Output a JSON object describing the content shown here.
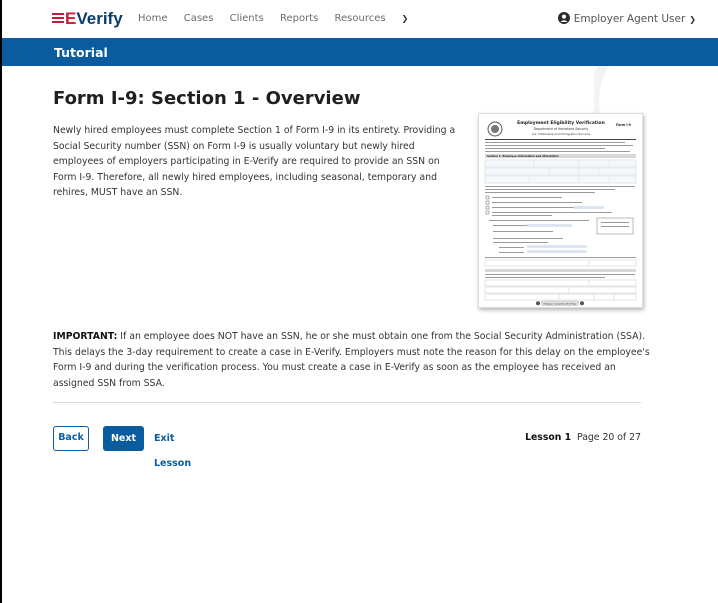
{
  "nav": {
    "logo_prefix": "E",
    "logo_suffix": "Verify",
    "links": [
      "Home",
      "Cases",
      "Clients",
      "Reports",
      "Resources"
    ],
    "user_label": "Employer Agent User"
  },
  "banner": {
    "title": "Tutorial"
  },
  "main": {
    "heading": "Form I-9: Section 1 - Overview",
    "intro": "Newly hired employees must complete Section 1 of Form I-9 in its entirety. Providing a Social Security number (SSN) on Form I-9 is usually voluntary but newly hired employees of employers participating in E-Verify are required to provide an SSN on Form I-9. Therefore, all newly hired employees, including seasonal, temporary and rehires, MUST have an SSN.",
    "important_label": "IMPORTANT:",
    "important_text": " If an employee does NOT have an SSN, he or she must obtain one from the Social Security Administration (SSA). This delays the 3-day requirement to create a case in E-Verify. Employers must note the reason for this delay on the employee's Form I-9 and during the verification process. You must create a case in E-Verify as soon as the employee has received an assigned SSN from SSA."
  },
  "form_image": {
    "title": "Employment Eligibility Verification",
    "dept": "Department of Homeland Security",
    "agency": "U.S. Citizenship and Immigration Services",
    "form_no": "Form I-9",
    "section1": "Section 1. Employee Information and Attestation",
    "footer_btn": "Employer Completes Next Page"
  },
  "footer": {
    "back_label": "Back",
    "next_label": "Next",
    "exit_label": "Exit Lesson",
    "lesson_label": "Lesson 1",
    "page_label": "Page 20 of 27"
  },
  "colors": {
    "brand_blue": "#0b5c9e",
    "brand_red": "#c41e3a"
  }
}
